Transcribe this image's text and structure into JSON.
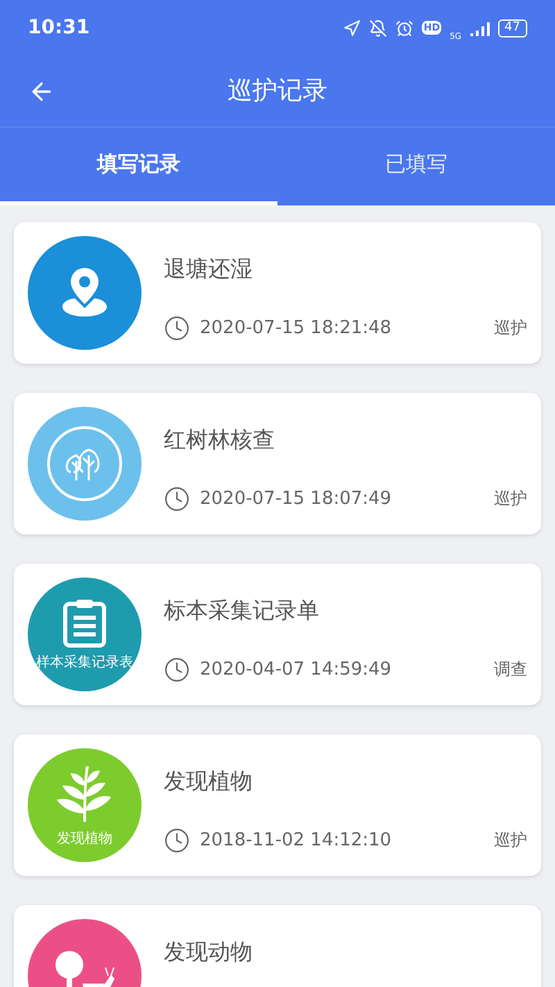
{
  "status_bar": {
    "time": "10:31",
    "hd": "HD",
    "network": "5G",
    "battery": "47"
  },
  "header": {
    "title": "巡护记录"
  },
  "tabs": [
    {
      "label": "填写记录",
      "selected": true
    },
    {
      "label": "已填写",
      "selected": false
    }
  ],
  "records": [
    {
      "kind": "pin",
      "color": "#1b8fd8",
      "title": "退塘还湿",
      "time": "2020-07-15 18:21:48",
      "tag": "巡护"
    },
    {
      "kind": "trees",
      "color": "#6cc0ec",
      "title": "红树林核查",
      "time": "2020-07-15 18:07:49",
      "tag": "巡护"
    },
    {
      "kind": "clipboard",
      "color": "#1e9cae",
      "icon_caption": "样本采集记录表",
      "title": "标本采集记录单",
      "time": "2020-04-07 14:59:49",
      "tag": "调查"
    },
    {
      "kind": "leaf",
      "color": "#7dcc2e",
      "icon_caption": "发现植物",
      "title": "发现植物",
      "time": "2018-11-02 14:12:10",
      "tag": "巡护"
    },
    {
      "kind": "animal",
      "color": "#ec4f86",
      "title": "发现动物"
    }
  ]
}
